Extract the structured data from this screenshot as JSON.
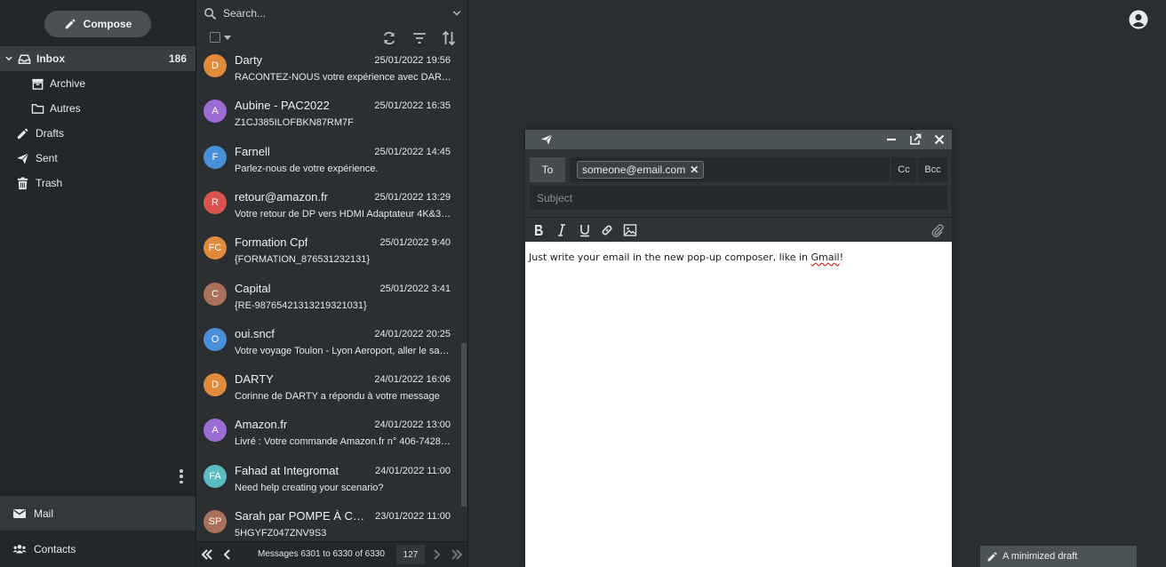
{
  "sidebar": {
    "compose_label": "Compose",
    "folders": [
      {
        "label": "Inbox",
        "count": "186",
        "icon": "inbox-icon"
      },
      {
        "label": "Archive",
        "icon": "archive-icon"
      },
      {
        "label": "Autres",
        "icon": "folder-icon"
      },
      {
        "label": "Drafts",
        "icon": "pencil-icon"
      },
      {
        "label": "Sent",
        "icon": "send-icon"
      },
      {
        "label": "Trash",
        "icon": "trash-icon"
      }
    ],
    "nav": {
      "mail": "Mail",
      "contacts": "Contacts"
    }
  },
  "list": {
    "search_placeholder": "Search...",
    "messages": [
      {
        "initials": "D",
        "color": "#e08a3c",
        "sender": "Darty",
        "date": "25/01/2022 19:56",
        "subject": "RACONTEZ-NOUS votre expérience avec DARTY"
      },
      {
        "initials": "A",
        "color": "#9b6bd6",
        "sender": "Aubine - PAC2022",
        "date": "25/01/2022 16:35",
        "subject": "Z1CJ385ILOFBKN87RM7F"
      },
      {
        "initials": "F",
        "color": "#4a90d9",
        "sender": "Farnell",
        "date": "25/01/2022 14:45",
        "subject": "Parlez-nous de votre expérience."
      },
      {
        "initials": "R",
        "color": "#d9534f",
        "sender": "retour@amazon.fr",
        "date": "25/01/2022 13:29",
        "subject": "Votre retour de DP vers HDMI Adaptateur 4K&3…"
      },
      {
        "initials": "FC",
        "color": "#e08a3c",
        "sender": "Formation Cpf",
        "date": "25/01/2022 9:40",
        "subject": "{FORMATION_876531232131}"
      },
      {
        "initials": "C",
        "color": "#a9705a",
        "sender": "Capital",
        "date": "25/01/2022 3:41",
        "subject": "{RE-98765421313219321031}"
      },
      {
        "initials": "O",
        "color": "#4a90d9",
        "sender": "oui.sncf",
        "date": "24/01/2022 20:25",
        "subject": "Votre voyage Toulon - Lyon Aeroport, aller le sa…"
      },
      {
        "initials": "D",
        "color": "#e08a3c",
        "sender": "DARTY",
        "date": "24/01/2022 16:06",
        "subject": "Corinne de DARTY a répondu à votre message"
      },
      {
        "initials": "A",
        "color": "#9b6bd6",
        "sender": "Amazon.fr",
        "date": "24/01/2022 13:00",
        "subject": "Livré : Votre commande Amazon.fr n° 406-7428…"
      },
      {
        "initials": "FA",
        "color": "#5bbcc4",
        "sender": "Fahad at Integromat",
        "date": "24/01/2022 11:00",
        "subject": "Need help creating your scenario?"
      },
      {
        "initials": "SP",
        "color": "#a9705a",
        "sender": "Sarah par POMPE À C…",
        "date": "23/01/2022 11:00",
        "subject": "5HGYFZ047ZNV9S3"
      }
    ],
    "pager": {
      "text": "Messages 6301 to 6330 of 6330",
      "page": "127"
    }
  },
  "composer": {
    "to_label": "To",
    "recipient": "someone@email.com",
    "cc_label": "Cc",
    "bcc_label": "Bcc",
    "subject_placeholder": "Subject",
    "body_before": "Just write your email in the new pop-up composer, like in ",
    "body_misspelled": "Gmail",
    "body_after": "!"
  },
  "minimized_draft": {
    "label": "A minimized draft"
  }
}
